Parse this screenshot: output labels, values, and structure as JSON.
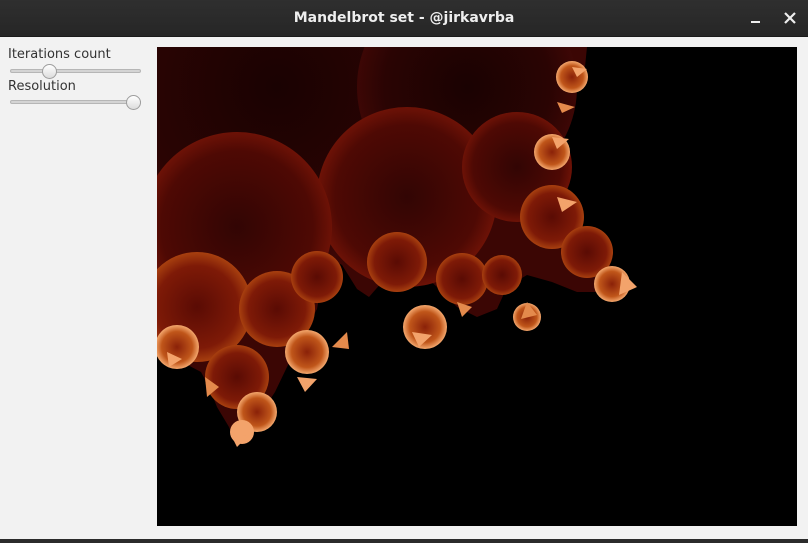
{
  "window": {
    "title": "Mandelbrot set - @jirkavrba"
  },
  "controls": {
    "iterations_label": "Iterations count",
    "iterations_level": 0.28,
    "resolution_label": "Resolution",
    "resolution_level": 1.0
  },
  "colors": {
    "canvas_background": "#000000",
    "fractal_dark": "#1f0303",
    "fractal_mid": "#5a0a04",
    "fractal_edge": "#a3300f",
    "fractal_glow": "#f3a36b"
  }
}
